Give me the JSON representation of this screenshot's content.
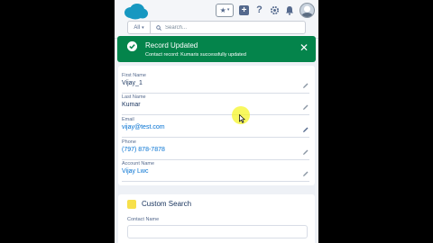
{
  "header": {
    "logo": "salesforce-cloud-logo",
    "icons": [
      "favorites-icon",
      "add-icon",
      "help-icon",
      "gear-icon",
      "bell-icon",
      "avatar"
    ]
  },
  "search": {
    "scope_label": "All",
    "placeholder": "Search..."
  },
  "toast": {
    "title": "Record Updated",
    "message": "Contact record: Kumaris successfully updated",
    "close": "✕",
    "color": "#04844b"
  },
  "record": {
    "fields": [
      {
        "label": "First Name",
        "value": "Vijay_1"
      },
      {
        "label": "Last Name",
        "value": "Kumar"
      },
      {
        "label": "Email",
        "value": "vijay@test.com"
      },
      {
        "label": "Phone",
        "value": "(797) 878-7878"
      },
      {
        "label": "Account Name",
        "value": "Vijay Lwc"
      }
    ]
  },
  "custom_search": {
    "title": "Custom Search",
    "field_label": "Contact Name",
    "field_value": ""
  }
}
